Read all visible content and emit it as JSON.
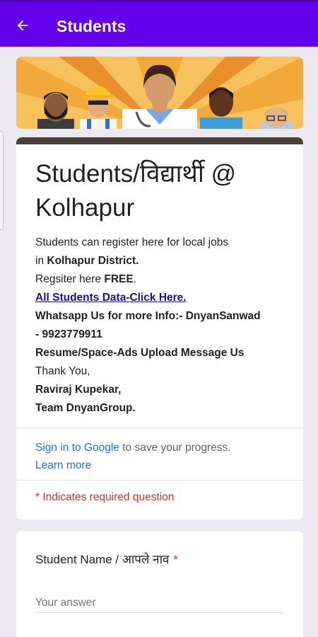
{
  "appbar": {
    "title": "Students"
  },
  "form": {
    "title": "Students/विद्यार्थी @ Kolhapur",
    "description": {
      "line1": "Students can register here for local jobs",
      "line2_prefix": "in ",
      "line2_bold": "Kolhapur District.",
      "line3_prefix": "Regsiter here ",
      "line3_bold": "FREE",
      "line3_suffix": ".",
      "link": "All Students Data-Click Here.",
      "line5": "Whatsapp Us for more Info:- DnyanSanwad",
      "line6": "- 9923779911",
      "line7": "Resume/Space-Ads Upload Message Us",
      "line8": "Thank You,",
      "line9": "Raviraj Kupekar,",
      "line10": "Team DnyanGroup."
    },
    "signin": {
      "link": "Sign in to Google",
      "text": " to save your progress.",
      "learn_more": "Learn more"
    },
    "required_note": "* Indicates required question"
  },
  "question": {
    "label": "Student Name / आपले नाव",
    "required_mark": "*",
    "placeholder": "Your answer"
  },
  "colors": {
    "appbar": "#6200ea",
    "accent_stripe": "#4a3f3a",
    "required": "#d93025",
    "link": "#1a73e8"
  }
}
